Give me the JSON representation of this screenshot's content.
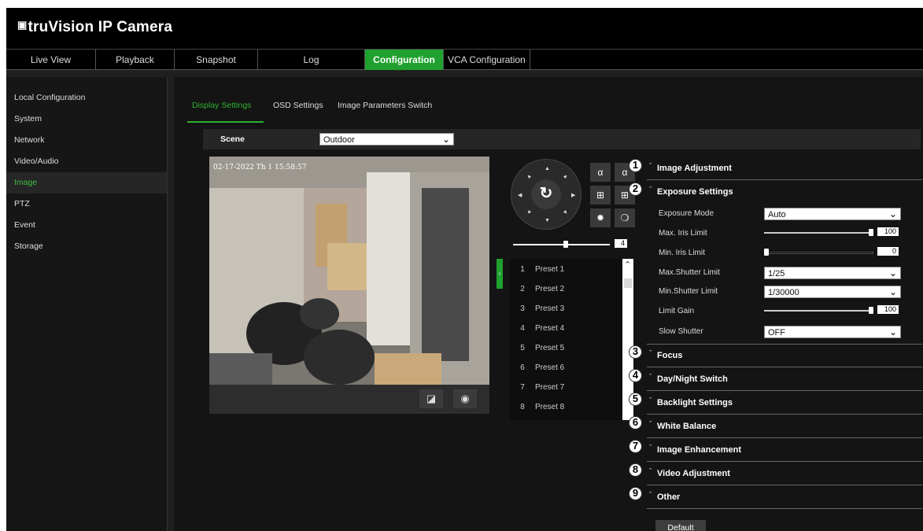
{
  "app": {
    "title": "truVision IP Camera"
  },
  "nav": {
    "tabs": [
      {
        "label": "Live View"
      },
      {
        "label": "Playback"
      },
      {
        "label": "Snapshot"
      },
      {
        "label": "Log"
      },
      {
        "label": "Configuration"
      },
      {
        "label": "VCA Configuration"
      }
    ],
    "active": "Configuration"
  },
  "sidebar": {
    "items": [
      {
        "label": "Local Configuration"
      },
      {
        "label": "System"
      },
      {
        "label": "Network"
      },
      {
        "label": "Video/Audio"
      },
      {
        "label": "Image"
      },
      {
        "label": "PTZ"
      },
      {
        "label": "Event"
      },
      {
        "label": "Storage"
      }
    ],
    "active": "Image"
  },
  "subtabs": [
    {
      "label": "Display Settings"
    },
    {
      "label": "OSD Settings"
    },
    {
      "label": "Image Parameters Switch"
    }
  ],
  "scene": {
    "label": "Scene",
    "value": "Outdoor"
  },
  "video": {
    "timestamp": "02-17-2022 Th 1 15:58:57"
  },
  "ptz": {
    "speed_value": "4",
    "speed_fraction": 0.55
  },
  "presets": [
    {
      "num": "1",
      "name": "Preset 1"
    },
    {
      "num": "2",
      "name": "Preset 2"
    },
    {
      "num": "3",
      "name": "Preset 3"
    },
    {
      "num": "4",
      "name": "Preset 4"
    },
    {
      "num": "5",
      "name": "Preset 5"
    },
    {
      "num": "6",
      "name": "Preset 6"
    },
    {
      "num": "7",
      "name": "Preset 7"
    },
    {
      "num": "8",
      "name": "Preset 8"
    }
  ],
  "sections": {
    "image_adjustment": "Image Adjustment",
    "exposure_settings": "Exposure Settings",
    "focus": "Focus",
    "day_night": "Day/Night Switch",
    "backlight": "Backlight Settings",
    "white_balance": "White Balance",
    "image_enhancement": "Image Enhancement",
    "video_adjustment": "Video Adjustment",
    "other": "Other"
  },
  "exposure": {
    "mode_label": "Exposure Mode",
    "mode_value": "Auto",
    "max_iris_label": "Max. Iris Limit",
    "max_iris_value": "100",
    "max_iris_fraction": 1.0,
    "min_iris_label": "Min. Iris Limit",
    "min_iris_value": "0",
    "min_iris_fraction": 0.0,
    "max_shutter_label": "Max.Shutter Limit",
    "max_shutter_value": "1/25",
    "min_shutter_label": "Min.Shutter Limit",
    "min_shutter_value": "1/30000",
    "limit_gain_label": "Limit Gain",
    "limit_gain_value": "100",
    "limit_gain_fraction": 1.0,
    "slow_shutter_label": "Slow Shutter",
    "slow_shutter_value": "OFF"
  },
  "callouts": [
    "1",
    "2",
    "3",
    "4",
    "5",
    "6",
    "7",
    "8",
    "9"
  ],
  "buttons": {
    "default": "Default"
  },
  "colors": {
    "accent": "#1fa02f",
    "background": "#1f1f1f",
    "header": "#000000"
  }
}
